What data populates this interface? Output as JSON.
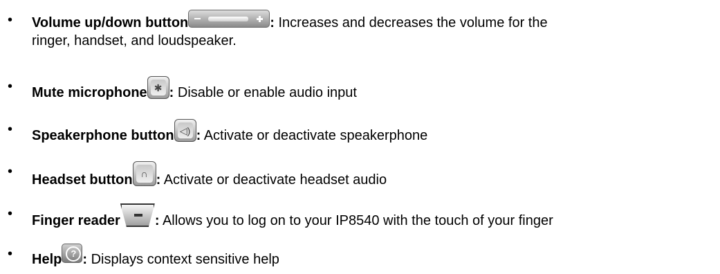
{
  "items": [
    {
      "term": "Volume up/down button",
      "colon": ":",
      "desc_line1": " Increases and decreases the volume for the",
      "desc_line2": "ringer, handset, and loudspeaker.",
      "icon": "volume-slider-icon"
    },
    {
      "term": "Mute microphone",
      "colon": ":",
      "desc": " Disable or enable audio input",
      "icon": "mute-microphone-icon"
    },
    {
      "term": "Speakerphone button",
      "colon": ":",
      "desc": "  Activate or deactivate speakerphone",
      "icon": "speaker-icon"
    },
    {
      "term": "Headset button",
      "colon": ":",
      "desc": "  Activate or deactivate headset audio",
      "icon": "headset-icon"
    },
    {
      "term": "Finger reader",
      "colon": ":",
      "desc": "   Allows you to log on to your IP8540 with the touch of your finger",
      "icon": "finger-reader-icon"
    },
    {
      "term": "Help",
      "colon": ":",
      "desc": " Displays context sensitive help",
      "icon": "help-icon"
    }
  ],
  "bullet": "•"
}
